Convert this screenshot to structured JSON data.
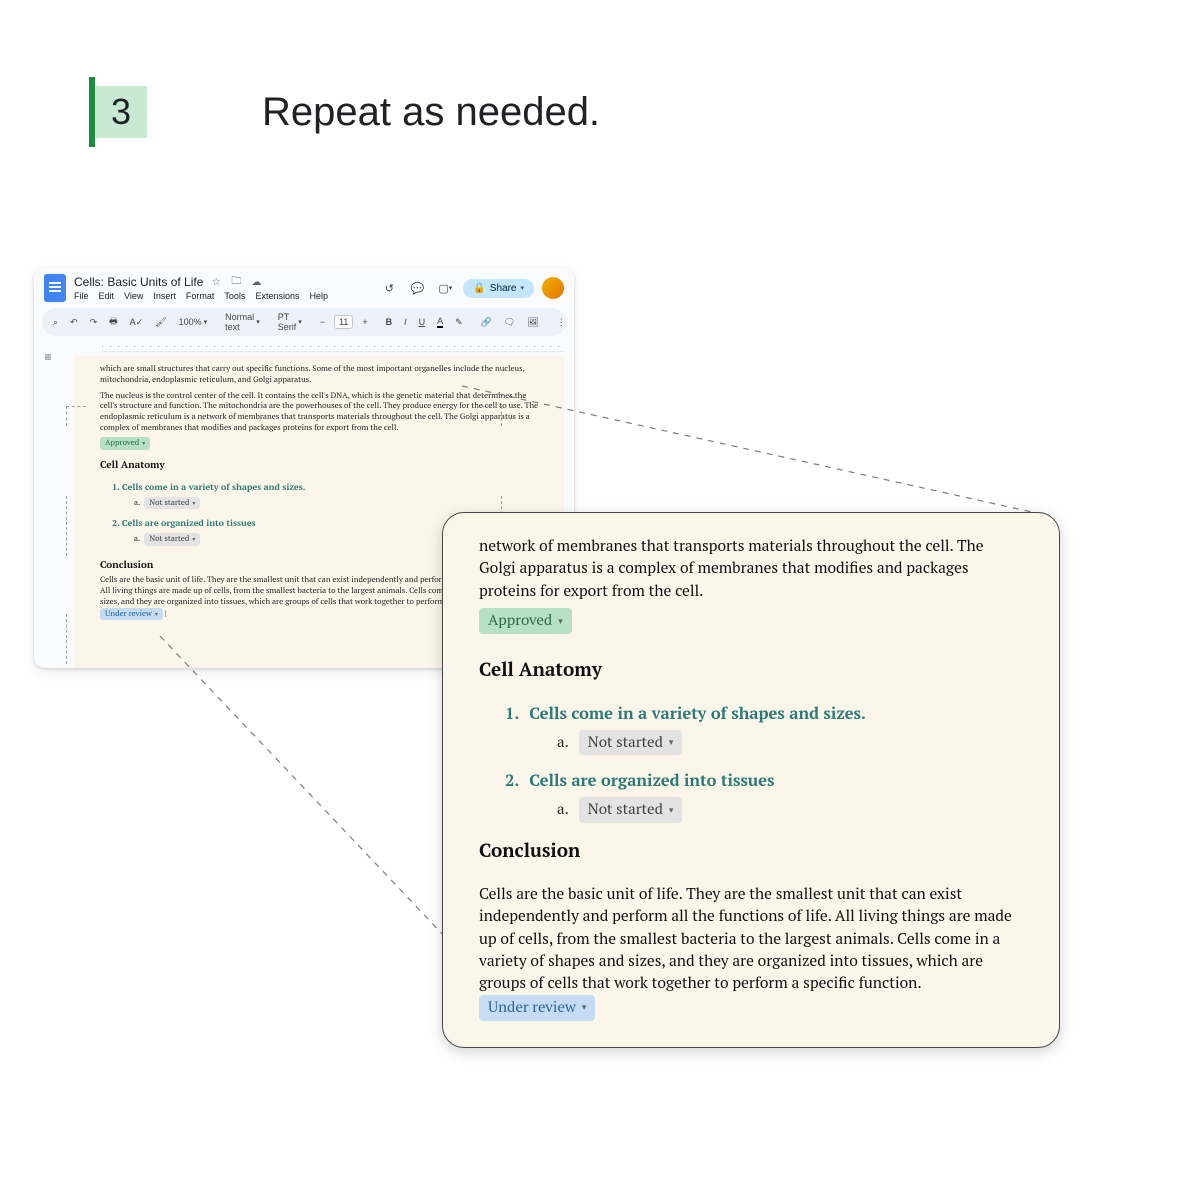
{
  "step": {
    "number": "3",
    "title": "Repeat as needed."
  },
  "docs": {
    "title": "Cells: Basic Units of Life",
    "menus": [
      "File",
      "Edit",
      "View",
      "Insert",
      "Format",
      "Tools",
      "Extensions",
      "Help"
    ],
    "share_label": "Share",
    "toolbar": {
      "zoom": "100%",
      "style": "Normal text",
      "font": "PT Serif",
      "font_size": "11"
    }
  },
  "body": {
    "para0": "which are small structures that carry out specific functions. Some of the most important organelles include the nucleus, mitochondria, endoplasmic reticulum, and Golgi apparatus.",
    "para1": "The nucleus is the control center of the cell. It contains the cell's DNA, which is the genetic material that determines the cell's structure and function. The mitochondria are the powerhouses of the cell. They produce energy for the cell to use. The endoplasmic reticulum is a network of membranes that transports materials throughout the cell. The Golgi apparatus is a complex of membranes that modifies and packages proteins for export from the cell.",
    "chip_approved": "Approved",
    "h_anatomy": "Cell Anatomy",
    "list": [
      {
        "num": "1.",
        "text": "Cells come in a variety of shapes and sizes.",
        "sub_letter": "a.",
        "chip": "Not started"
      },
      {
        "num": "2.",
        "text": "Cells are organized into tissues",
        "sub_letter": "a.",
        "chip": "Not started"
      }
    ],
    "h_conclusion": "Conclusion",
    "para_conclusion": "Cells are the basic unit of life. They are the smallest unit that can exist independently and perform all the functions of life. All living things are made up of cells, from the smallest bacteria to the largest animals. Cells come in a variety of shapes and sizes, and they are organized into tissues, which are groups of cells that work together to perform a specific function.",
    "chip_review": "Under review"
  },
  "zoom": {
    "para_top": "network of membranes that transports materials throughout the cell. The Golgi apparatus is a complex of membranes that modifies and packages proteins for export from the cell."
  }
}
